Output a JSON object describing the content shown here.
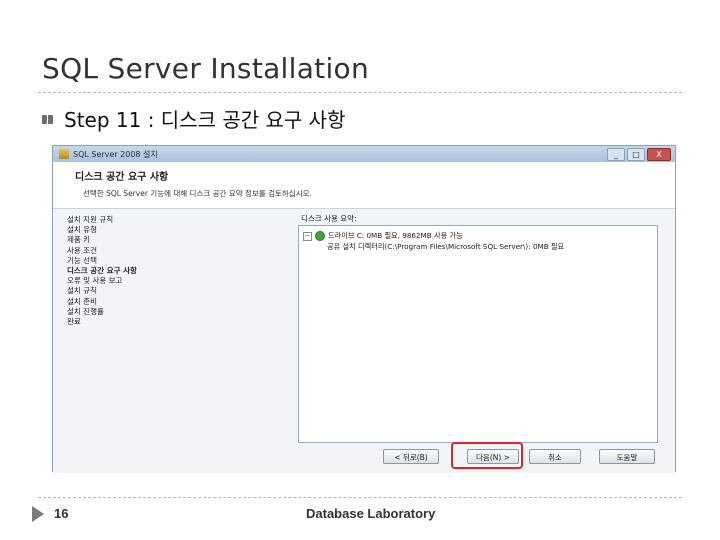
{
  "slide": {
    "title": "SQL Server Installation",
    "bullet": "Step 11 : 디스크 공간 요구 사항",
    "page_number": "16",
    "footer": "Database Laboratory"
  },
  "window": {
    "title": "SQL Server 2008 설치",
    "controls": {
      "minimize": "_",
      "maximize": "□",
      "close": "X"
    },
    "header": {
      "title": "디스크 공간 요구 사항",
      "subtitle": "선택한 SQL Server 기능에 대해 디스크 공간 요약 정보를 검토하십시오."
    },
    "steps": [
      "설치 지원 규칙",
      "설치 유형",
      "제품 키",
      "사용 조건",
      "기능 선택",
      "디스크 공간 요구 사항",
      "오류 및 사용 보고",
      "설치 규칙",
      "설치 준비",
      "설치 진행률",
      "완료"
    ],
    "requirements": {
      "label": "디스크 사용 요약:",
      "drive_row": "드라이브 C: 0MB 필요, 9862MB 사용 가능",
      "folder_row": "공유 설치 디렉터리(C:\\Program Files\\Microsoft SQL Server\\): 0MB 필요"
    },
    "buttons": {
      "back": "< 뒤로(B)",
      "next": "다음(N) >",
      "cancel": "취소",
      "help": "도움말"
    }
  },
  "colors": {
    "highlight": "#d62a2a",
    "titlebar": "#b8cde4",
    "status_ok": "#3fa63f"
  }
}
